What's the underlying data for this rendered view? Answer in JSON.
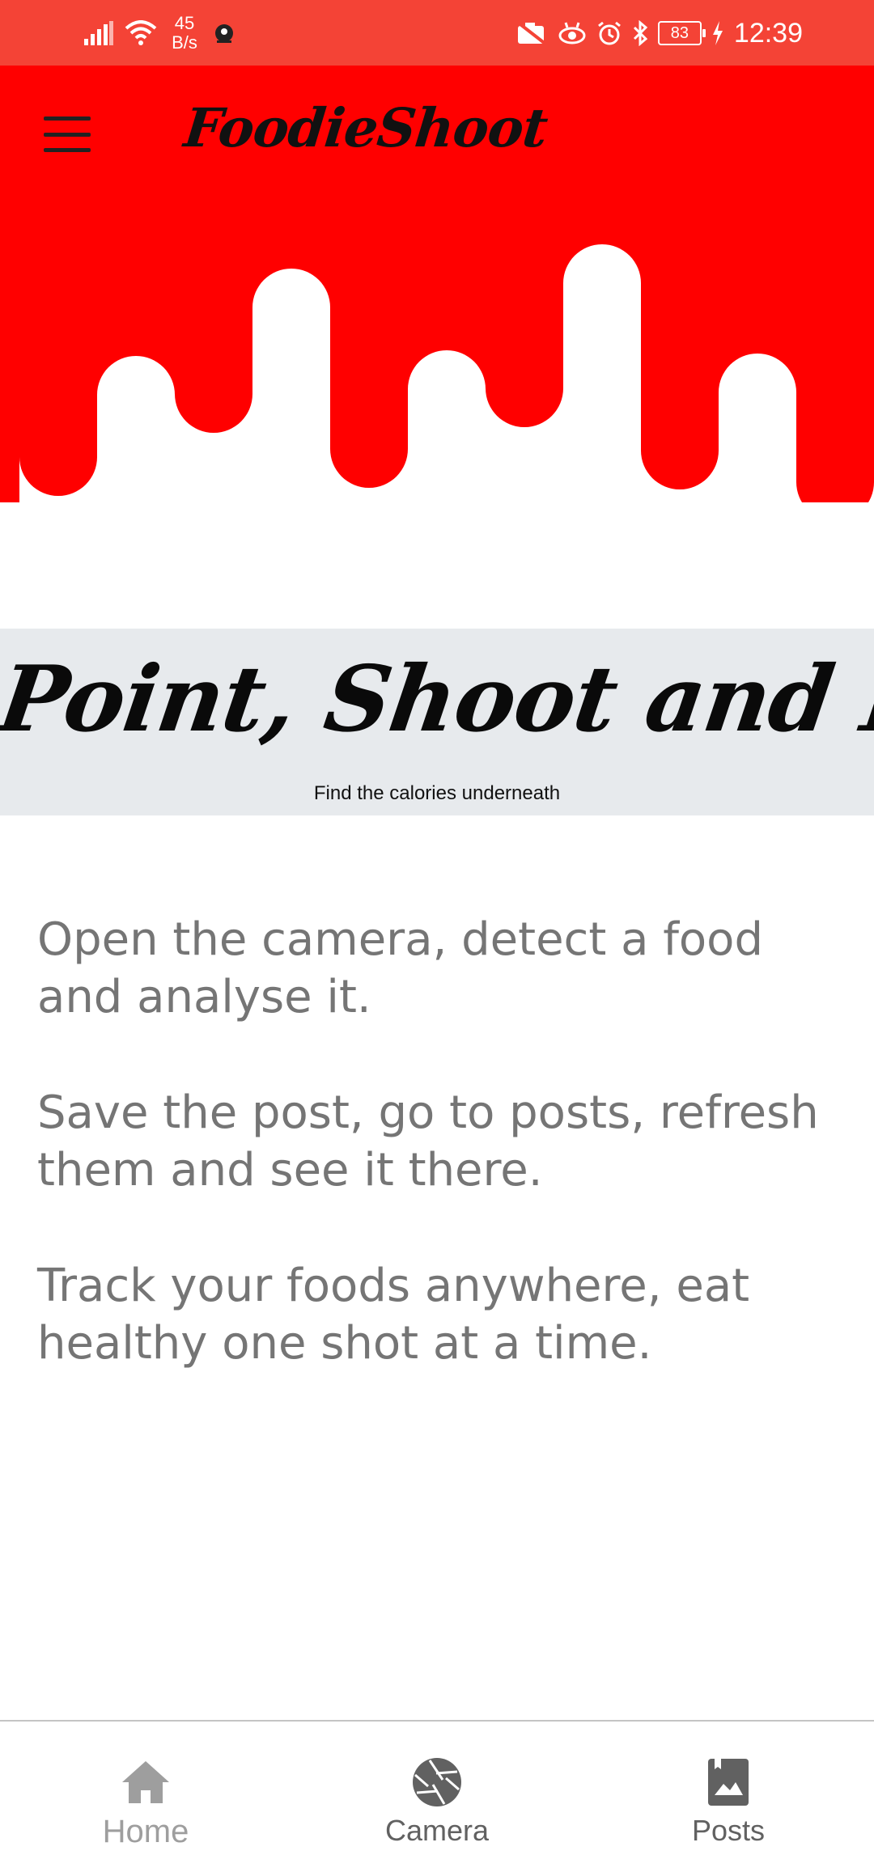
{
  "status_bar": {
    "network_speed_value": "45",
    "network_speed_unit": "B/s",
    "battery": "83",
    "time": "12:39",
    "icons": [
      "signal-icon",
      "wifi-icon",
      "app-notification-icon",
      "camera-off-icon",
      "eye-comfort-icon",
      "alarm-icon",
      "bluetooth-icon",
      "battery-icon",
      "charging-icon"
    ]
  },
  "header": {
    "app_title": "FoodieShoot",
    "menu_icon": "hamburger-menu-icon",
    "colors": {
      "drip": "#ff0000",
      "status_bar": "#f44336"
    }
  },
  "banner": {
    "heading": "Point, Shoot and Eat",
    "subtitle": "Find the calories underneath",
    "background": "#e7eaed"
  },
  "content": {
    "paragraphs": [
      "Open the camera, detect a food and analyse it.",
      "Save the post, go to posts, refresh them and see it there.",
      "Track your foods anywhere, eat healthy one shot at a time."
    ]
  },
  "bottom_nav": {
    "items": [
      {
        "label": "Home",
        "icon": "home-icon"
      },
      {
        "label": "Camera",
        "icon": "camera-aperture-icon"
      },
      {
        "label": "Posts",
        "icon": "image-album-icon"
      }
    ]
  }
}
